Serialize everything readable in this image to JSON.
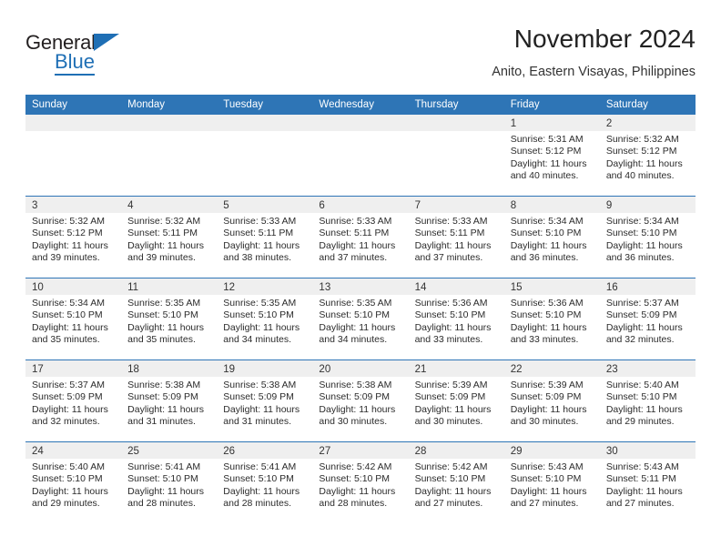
{
  "logo": {
    "word1": "General",
    "word2": "Blue",
    "triangle_color": "#1f6fb5",
    "icon": "triangle-icon"
  },
  "header": {
    "title": "November 2024",
    "subtitle": "Anito, Eastern Visayas, Philippines"
  },
  "colors": {
    "header_blue": "#2e75b6",
    "day_band_shaded": "#efefef",
    "text": "#2b2b2b"
  },
  "calendar": {
    "weekdays": [
      "Sunday",
      "Monday",
      "Tuesday",
      "Wednesday",
      "Thursday",
      "Friday",
      "Saturday"
    ],
    "weeks": [
      [
        {
          "day": "",
          "empty": true,
          "shaded": true,
          "sunrise": "",
          "sunset": "",
          "daylight1": "",
          "daylight2": ""
        },
        {
          "day": "",
          "empty": true,
          "shaded": true,
          "sunrise": "",
          "sunset": "",
          "daylight1": "",
          "daylight2": ""
        },
        {
          "day": "",
          "empty": true,
          "shaded": true,
          "sunrise": "",
          "sunset": "",
          "daylight1": "",
          "daylight2": ""
        },
        {
          "day": "",
          "empty": true,
          "shaded": true,
          "sunrise": "",
          "sunset": "",
          "daylight1": "",
          "daylight2": ""
        },
        {
          "day": "",
          "empty": true,
          "shaded": true,
          "sunrise": "",
          "sunset": "",
          "daylight1": "",
          "daylight2": ""
        },
        {
          "day": "1",
          "empty": false,
          "shaded": true,
          "sunrise": "Sunrise: 5:31 AM",
          "sunset": "Sunset: 5:12 PM",
          "daylight1": "Daylight: 11 hours",
          "daylight2": "and 40 minutes."
        },
        {
          "day": "2",
          "empty": false,
          "shaded": true,
          "sunrise": "Sunrise: 5:32 AM",
          "sunset": "Sunset: 5:12 PM",
          "daylight1": "Daylight: 11 hours",
          "daylight2": "and 40 minutes."
        }
      ],
      [
        {
          "day": "3",
          "empty": false,
          "shaded": true,
          "sunrise": "Sunrise: 5:32 AM",
          "sunset": "Sunset: 5:12 PM",
          "daylight1": "Daylight: 11 hours",
          "daylight2": "and 39 minutes."
        },
        {
          "day": "4",
          "empty": false,
          "shaded": true,
          "sunrise": "Sunrise: 5:32 AM",
          "sunset": "Sunset: 5:11 PM",
          "daylight1": "Daylight: 11 hours",
          "daylight2": "and 39 minutes."
        },
        {
          "day": "5",
          "empty": false,
          "shaded": true,
          "sunrise": "Sunrise: 5:33 AM",
          "sunset": "Sunset: 5:11 PM",
          "daylight1": "Daylight: 11 hours",
          "daylight2": "and 38 minutes."
        },
        {
          "day": "6",
          "empty": false,
          "shaded": true,
          "sunrise": "Sunrise: 5:33 AM",
          "sunset": "Sunset: 5:11 PM",
          "daylight1": "Daylight: 11 hours",
          "daylight2": "and 37 minutes."
        },
        {
          "day": "7",
          "empty": false,
          "shaded": true,
          "sunrise": "Sunrise: 5:33 AM",
          "sunset": "Sunset: 5:11 PM",
          "daylight1": "Daylight: 11 hours",
          "daylight2": "and 37 minutes."
        },
        {
          "day": "8",
          "empty": false,
          "shaded": true,
          "sunrise": "Sunrise: 5:34 AM",
          "sunset": "Sunset: 5:10 PM",
          "daylight1": "Daylight: 11 hours",
          "daylight2": "and 36 minutes."
        },
        {
          "day": "9",
          "empty": false,
          "shaded": true,
          "sunrise": "Sunrise: 5:34 AM",
          "sunset": "Sunset: 5:10 PM",
          "daylight1": "Daylight: 11 hours",
          "daylight2": "and 36 minutes."
        }
      ],
      [
        {
          "day": "10",
          "empty": false,
          "shaded": true,
          "sunrise": "Sunrise: 5:34 AM",
          "sunset": "Sunset: 5:10 PM",
          "daylight1": "Daylight: 11 hours",
          "daylight2": "and 35 minutes."
        },
        {
          "day": "11",
          "empty": false,
          "shaded": true,
          "sunrise": "Sunrise: 5:35 AM",
          "sunset": "Sunset: 5:10 PM",
          "daylight1": "Daylight: 11 hours",
          "daylight2": "and 35 minutes."
        },
        {
          "day": "12",
          "empty": false,
          "shaded": true,
          "sunrise": "Sunrise: 5:35 AM",
          "sunset": "Sunset: 5:10 PM",
          "daylight1": "Daylight: 11 hours",
          "daylight2": "and 34 minutes."
        },
        {
          "day": "13",
          "empty": false,
          "shaded": true,
          "sunrise": "Sunrise: 5:35 AM",
          "sunset": "Sunset: 5:10 PM",
          "daylight1": "Daylight: 11 hours",
          "daylight2": "and 34 minutes."
        },
        {
          "day": "14",
          "empty": false,
          "shaded": true,
          "sunrise": "Sunrise: 5:36 AM",
          "sunset": "Sunset: 5:10 PM",
          "daylight1": "Daylight: 11 hours",
          "daylight2": "and 33 minutes."
        },
        {
          "day": "15",
          "empty": false,
          "shaded": true,
          "sunrise": "Sunrise: 5:36 AM",
          "sunset": "Sunset: 5:10 PM",
          "daylight1": "Daylight: 11 hours",
          "daylight2": "and 33 minutes."
        },
        {
          "day": "16",
          "empty": false,
          "shaded": true,
          "sunrise": "Sunrise: 5:37 AM",
          "sunset": "Sunset: 5:09 PM",
          "daylight1": "Daylight: 11 hours",
          "daylight2": "and 32 minutes."
        }
      ],
      [
        {
          "day": "17",
          "empty": false,
          "shaded": true,
          "sunrise": "Sunrise: 5:37 AM",
          "sunset": "Sunset: 5:09 PM",
          "daylight1": "Daylight: 11 hours",
          "daylight2": "and 32 minutes."
        },
        {
          "day": "18",
          "empty": false,
          "shaded": true,
          "sunrise": "Sunrise: 5:38 AM",
          "sunset": "Sunset: 5:09 PM",
          "daylight1": "Daylight: 11 hours",
          "daylight2": "and 31 minutes."
        },
        {
          "day": "19",
          "empty": false,
          "shaded": true,
          "sunrise": "Sunrise: 5:38 AM",
          "sunset": "Sunset: 5:09 PM",
          "daylight1": "Daylight: 11 hours",
          "daylight2": "and 31 minutes."
        },
        {
          "day": "20",
          "empty": false,
          "shaded": true,
          "sunrise": "Sunrise: 5:38 AM",
          "sunset": "Sunset: 5:09 PM",
          "daylight1": "Daylight: 11 hours",
          "daylight2": "and 30 minutes."
        },
        {
          "day": "21",
          "empty": false,
          "shaded": true,
          "sunrise": "Sunrise: 5:39 AM",
          "sunset": "Sunset: 5:09 PM",
          "daylight1": "Daylight: 11 hours",
          "daylight2": "and 30 minutes."
        },
        {
          "day": "22",
          "empty": false,
          "shaded": true,
          "sunrise": "Sunrise: 5:39 AM",
          "sunset": "Sunset: 5:09 PM",
          "daylight1": "Daylight: 11 hours",
          "daylight2": "and 30 minutes."
        },
        {
          "day": "23",
          "empty": false,
          "shaded": true,
          "sunrise": "Sunrise: 5:40 AM",
          "sunset": "Sunset: 5:10 PM",
          "daylight1": "Daylight: 11 hours",
          "daylight2": "and 29 minutes."
        }
      ],
      [
        {
          "day": "24",
          "empty": false,
          "shaded": true,
          "sunrise": "Sunrise: 5:40 AM",
          "sunset": "Sunset: 5:10 PM",
          "daylight1": "Daylight: 11 hours",
          "daylight2": "and 29 minutes."
        },
        {
          "day": "25",
          "empty": false,
          "shaded": true,
          "sunrise": "Sunrise: 5:41 AM",
          "sunset": "Sunset: 5:10 PM",
          "daylight1": "Daylight: 11 hours",
          "daylight2": "and 28 minutes."
        },
        {
          "day": "26",
          "empty": false,
          "shaded": true,
          "sunrise": "Sunrise: 5:41 AM",
          "sunset": "Sunset: 5:10 PM",
          "daylight1": "Daylight: 11 hours",
          "daylight2": "and 28 minutes."
        },
        {
          "day": "27",
          "empty": false,
          "shaded": true,
          "sunrise": "Sunrise: 5:42 AM",
          "sunset": "Sunset: 5:10 PM",
          "daylight1": "Daylight: 11 hours",
          "daylight2": "and 28 minutes."
        },
        {
          "day": "28",
          "empty": false,
          "shaded": true,
          "sunrise": "Sunrise: 5:42 AM",
          "sunset": "Sunset: 5:10 PM",
          "daylight1": "Daylight: 11 hours",
          "daylight2": "and 27 minutes."
        },
        {
          "day": "29",
          "empty": false,
          "shaded": true,
          "sunrise": "Sunrise: 5:43 AM",
          "sunset": "Sunset: 5:10 PM",
          "daylight1": "Daylight: 11 hours",
          "daylight2": "and 27 minutes."
        },
        {
          "day": "30",
          "empty": false,
          "shaded": true,
          "sunrise": "Sunrise: 5:43 AM",
          "sunset": "Sunset: 5:11 PM",
          "daylight1": "Daylight: 11 hours",
          "daylight2": "and 27 minutes."
        }
      ]
    ]
  }
}
